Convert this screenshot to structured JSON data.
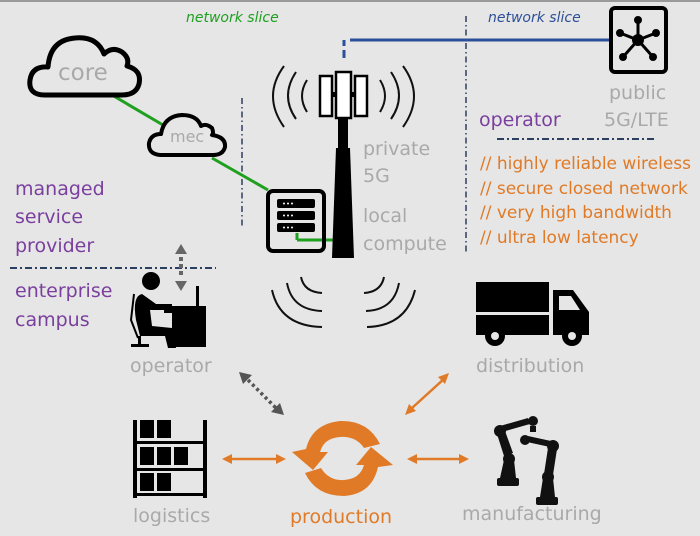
{
  "colors": {
    "background": "#e6e6e6",
    "slice_green": "#1fa01f",
    "slice_blue": "#2c4f9a",
    "accent_orange": "#e07a26",
    "purple": "#7a3f9e",
    "label_gray": "#a9a9a9",
    "divider_navy": "#2b3f63"
  },
  "slices": {
    "green_label": "network slice",
    "blue_label": "network slice"
  },
  "clouds": {
    "core": "core",
    "mec": "mec"
  },
  "tower": {
    "label_line1": "private",
    "label_line2": "5G",
    "compute_line1": "local",
    "compute_line2": "compute"
  },
  "public_network": {
    "line1": "public",
    "line2": "5G/LTE",
    "operator_label": "operator"
  },
  "benefits": [
    "// highly reliable wireless",
    "// secure closed network",
    "// very high bandwidth",
    "// ultra low latency"
  ],
  "zones": {
    "msp_line1": "managed",
    "msp_line2": "service",
    "msp_line3": "provider",
    "enterprise_line1": "enterprise",
    "enterprise_line2": "campus"
  },
  "nodes": {
    "operator": "operator",
    "distribution": "distribution",
    "logistics": "logistics",
    "production": "production",
    "manufacturing": "manufacturing"
  }
}
